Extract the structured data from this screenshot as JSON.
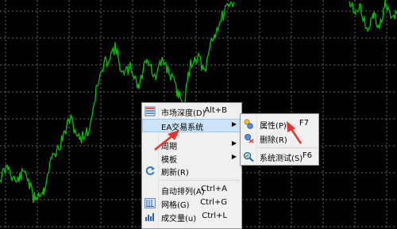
{
  "colors": {
    "background": "#000000",
    "grid": "#6b6b6b",
    "price_line": "#00c400",
    "menu_bg": "#f0f0f0",
    "highlight": "#cce4f7",
    "annotation_arrow": "#e8332a"
  },
  "context_menu": {
    "items": [
      {
        "label": "市场深度(D)",
        "shortcut": "Alt+B",
        "icon": "market-depth-icon"
      },
      {
        "label": "EA交易系统",
        "shortcut": "",
        "submenu": true,
        "icon": ""
      },
      {
        "label": "周期",
        "shortcut": "",
        "submenu": true,
        "icon": ""
      },
      {
        "label": "模板",
        "shortcut": "",
        "submenu": true,
        "icon": ""
      },
      {
        "label": "刷新(R)",
        "shortcut": "",
        "icon": "refresh-icon"
      },
      {
        "label": "自动排列(A)",
        "shortcut": "Ctrl+A",
        "icon": ""
      },
      {
        "label": "网格(G)",
        "shortcut": "Ctrl+G",
        "icon": "grid-icon"
      },
      {
        "label": "成交量(u)",
        "shortcut": "Ctrl+L",
        "icon": "volume-icon"
      }
    ]
  },
  "submenu": {
    "items": [
      {
        "label": "属性(P)...",
        "shortcut": "F7",
        "icon": "properties-icon"
      },
      {
        "label": "删除(R)",
        "shortcut": "",
        "icon": "remove-icon"
      },
      {
        "label": "系统测试(S)",
        "shortcut": "F6",
        "icon": "tester-icon"
      }
    ]
  }
}
